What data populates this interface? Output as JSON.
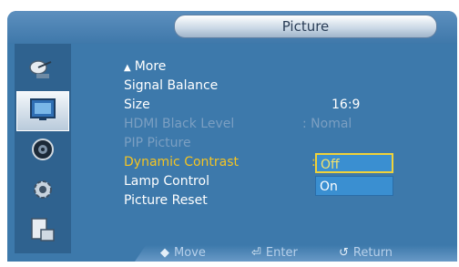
{
  "window": {
    "title": "Picture"
  },
  "sidebar": {
    "items": [
      {
        "icon": "satellite-icon",
        "selected": false
      },
      {
        "icon": "picture-icon",
        "selected": true
      },
      {
        "icon": "sound-icon",
        "selected": false
      },
      {
        "icon": "settings-gear-icon",
        "selected": false
      },
      {
        "icon": "multi-screen-icon",
        "selected": false
      }
    ]
  },
  "menu": {
    "more_label": "More",
    "more_glyph": "▲",
    "items": [
      {
        "label": "Signal Balance",
        "value": "",
        "state": "normal"
      },
      {
        "label": "Size",
        "value": "16:9",
        "state": "normal"
      },
      {
        "label": "HDMI Black Level",
        "value": ":  Nomal",
        "state": "disabled"
      },
      {
        "label": "PIP Picture",
        "value": "",
        "state": "disabled"
      },
      {
        "label": "Dynamic Contrast",
        "value": ":",
        "state": "highlight"
      },
      {
        "label": "Lamp Control",
        "value": "",
        "state": "normal"
      },
      {
        "label": "Picture Reset",
        "value": "",
        "state": "normal"
      }
    ]
  },
  "dropdown": {
    "options": [
      {
        "label": "Off",
        "selected": true
      },
      {
        "label": "On",
        "selected": false
      }
    ]
  },
  "footer": {
    "move_glyph": "◆",
    "move_label": "Move",
    "enter_glyph": "⏎",
    "enter_label": "Enter",
    "return_glyph": "↺",
    "return_label": "Return"
  },
  "colors": {
    "panel": "#3d79ab",
    "highlight": "#f4c423",
    "disabled": "#7b9fc2",
    "dropdown_bg": "#3a8fd1"
  }
}
